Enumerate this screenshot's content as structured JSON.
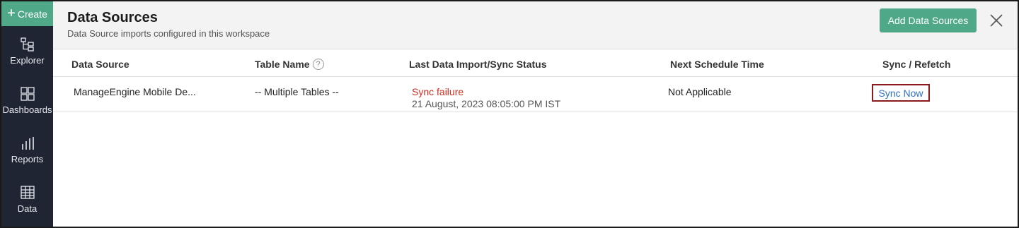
{
  "sidebar": {
    "create_label": "Create",
    "items": [
      {
        "label": "Explorer",
        "icon": "explorer-tree-icon"
      },
      {
        "label": "Dashboards",
        "icon": "dashboards-grid-icon"
      },
      {
        "label": "Reports",
        "icon": "reports-bars-icon"
      },
      {
        "label": "Data",
        "icon": "data-table-icon"
      }
    ]
  },
  "header": {
    "title": "Data Sources",
    "subtitle": "Data Source imports configured in this workspace",
    "add_label": "Add Data Sources",
    "close_icon": "close-icon"
  },
  "table": {
    "columns": [
      "Data Source",
      "Table Name",
      "Last Data Import/Sync Status",
      "Next Schedule Time",
      "Sync / Refetch"
    ],
    "rows": [
      {
        "data_source": "ManageEngine Mobile De...",
        "table_name": "-- Multiple Tables --",
        "status": "Sync failure",
        "status_time": "21 August, 2023 08:05:00 PM IST",
        "next_schedule": "Not Applicable",
        "action": "Sync Now"
      }
    ]
  },
  "colors": {
    "accent": "#4fa888",
    "sidebar_bg": "#1f2533",
    "failure": "#d42b1e",
    "link": "#2f6fc7",
    "highlight_border": "#8b1a1a"
  }
}
